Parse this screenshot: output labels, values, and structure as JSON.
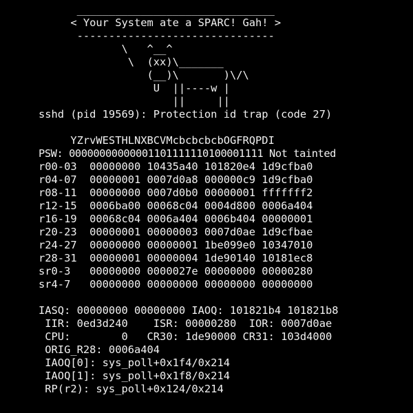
{
  "console": {
    "colors": {
      "background": "#000000",
      "text": "#f2f2f2"
    },
    "lines": [
      "      _______________________________",
      "     < Your System ate a SPARC! Gah! >",
      "      -------------------------------",
      "             \\   ^__^",
      "              \\  (xx)\\_______",
      "                 (__)\\       )\\/\\",
      "                  U  ||----w |",
      "                     ||     ||",
      "sshd (pid 19569): Protection id trap (code 27)",
      "",
      "     YZrvWESTHLNXBCVMcbcbcbcbOGFRQPDI",
      "PSW: 00000000000001101111110100001111 Not tainted",
      "r00-03  00000000 10435a40 101820e4 1d9cfba0",
      "r04-07  00000001 0007d0a8 000000c9 1d9cfba0",
      "r08-11  00000000 0007d0b0 00000001 fffffff2",
      "r12-15  0006ba00 00068c04 0004d800 0006a404",
      "r16-19  00068c04 0006a404 0006b404 00000001",
      "r20-23  00000001 00000003 0007d0ae 1d9cfbae",
      "r24-27  00000000 00000001 1be099e0 10347010",
      "r28-31  00000001 00000004 1de90140 10181ec8",
      "sr0-3   00000000 0000027e 00000000 00000280",
      "sr4-7   00000000 00000000 00000000 00000000",
      "",
      "IASQ: 00000000 00000000 IAOQ: 101821b4 101821b8",
      " IIR: 0ed3d240    ISR: 00000280  IOR: 0007d0ae",
      " CPU:        0   CR30: 1de90000 CR31: 103d4000",
      " ORIG_R28: 0006a404",
      " IAOQ[0]: sys_poll+0x1f4/0x214",
      " IAOQ[1]: sys_poll+0x1f8/0x214",
      " RP(r2): sys_poll+0x124/0x214"
    ]
  }
}
